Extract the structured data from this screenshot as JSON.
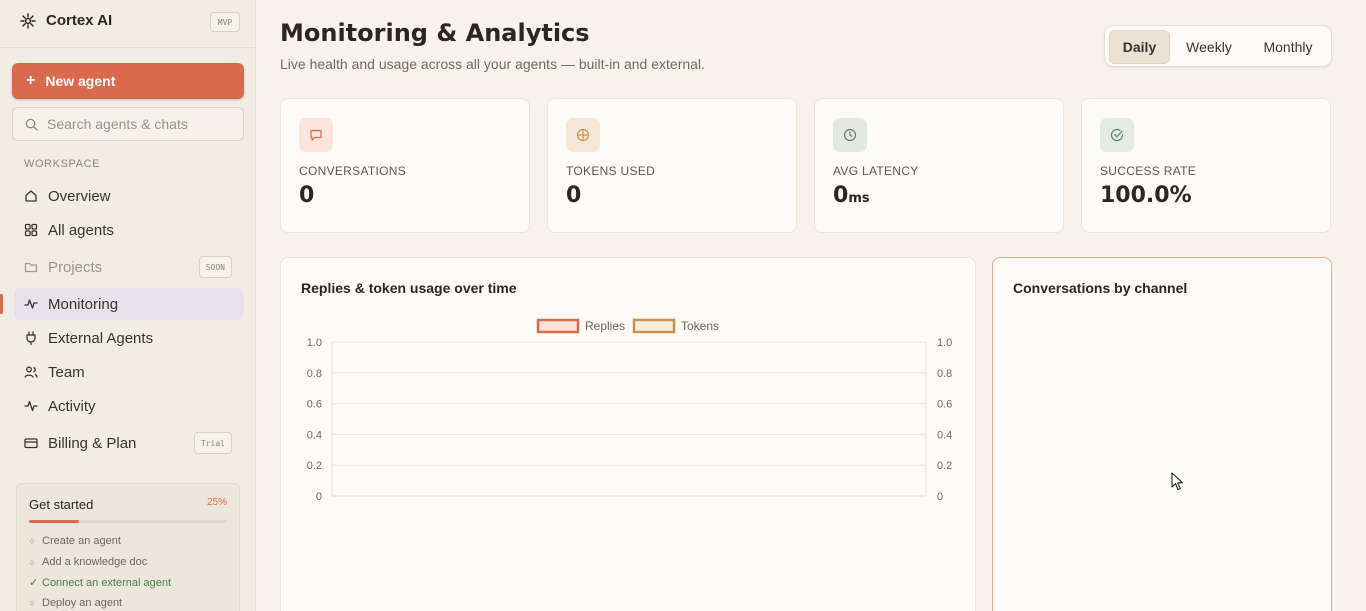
{
  "app": {
    "name": "Cortex AI",
    "badge": "MVP"
  },
  "sidebar": {
    "new_agent_label": "New agent",
    "search_placeholder": "Search agents & chats",
    "section_label": "WORKSPACE",
    "items": [
      {
        "label": "Overview",
        "icon": "home-icon"
      },
      {
        "label": "All agents",
        "icon": "grid-icon"
      },
      {
        "label": "Projects",
        "icon": "folder-icon",
        "badge": "SOON",
        "disabled": true
      },
      {
        "label": "Monitoring",
        "icon": "activity-icon",
        "active": true
      },
      {
        "label": "External Agents",
        "icon": "plug-icon"
      },
      {
        "label": "Team",
        "icon": "users-icon"
      },
      {
        "label": "Activity",
        "icon": "pulse-icon"
      },
      {
        "label": "Billing & Plan",
        "icon": "credit-card-icon",
        "badge": "Trial"
      }
    ],
    "get_started": {
      "title": "Get started",
      "percent_label": "25%",
      "progress": 0.25,
      "steps": [
        {
          "label": "Create an agent",
          "done": false
        },
        {
          "label": "Add a knowledge doc",
          "done": false
        },
        {
          "label": "Connect an external agent",
          "done": true
        },
        {
          "label": "Deploy an agent",
          "done": false
        }
      ]
    }
  },
  "header": {
    "title": "Monitoring & Analytics",
    "subtitle": "Live health and usage across all your agents — built-in and external.",
    "ranges": [
      "Daily",
      "Weekly",
      "Monthly"
    ],
    "active_range": "Daily"
  },
  "kpis": [
    {
      "label": "CONVERSATIONS",
      "value": "0",
      "unit": "",
      "icon": "message-icon",
      "tint": "#fbe4dc",
      "icon_color": "#d96a4e"
    },
    {
      "label": "TOKENS USED",
      "value": "0",
      "unit": "",
      "icon": "target-icon",
      "tint": "#f5e7d6",
      "icon_color": "#c9914f"
    },
    {
      "label": "AVG LATENCY",
      "value": "0",
      "unit": "ms",
      "icon": "clock-icon",
      "tint": "#e3e8e1",
      "icon_color": "#6f7c6a"
    },
    {
      "label": "SUCCESS RATE",
      "value": "100.0%",
      "unit": "",
      "icon": "check-circle-icon",
      "tint": "#e3ebe2",
      "icon_color": "#5e8466"
    }
  ],
  "panels": {
    "usage_title": "Replies & token usage over time",
    "channel_title": "Conversations by channel"
  },
  "chart_data": {
    "type": "line",
    "title": "",
    "x": [],
    "series": [
      {
        "name": "Replies",
        "values": [],
        "color": "#d96a4e",
        "axis": "left"
      },
      {
        "name": "Tokens",
        "values": [],
        "color": "#c9914f",
        "axis": "right"
      }
    ],
    "y_ticks": [
      "1.0",
      "0.8",
      "0.6",
      "0.4",
      "0.2",
      "0"
    ],
    "ylim": [
      0,
      1
    ],
    "y2lim": [
      0,
      1
    ],
    "grid": true,
    "legend": "top-center"
  }
}
